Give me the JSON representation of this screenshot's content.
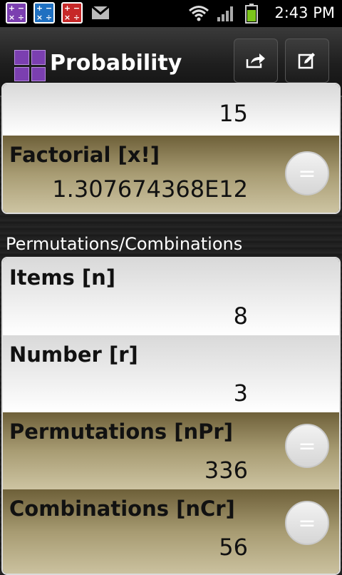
{
  "status_bar": {
    "time": "2:43 PM",
    "icons": [
      "calc-purple-icon",
      "calc-blue-icon",
      "calc-red-icon",
      "gmail-icon",
      "wifi-icon",
      "signal-icon",
      "battery-icon"
    ]
  },
  "action_bar": {
    "title": "Probability",
    "share_icon": "share-icon",
    "edit_icon": "edit-icon"
  },
  "factorial_section": {
    "input_value": "15",
    "factorial_label": "Factorial [x!]",
    "factorial_value": "1.307674368E12"
  },
  "perm_comb_section": {
    "title": "Permutations/Combinations",
    "items_label": "Items [n]",
    "items_value": "8",
    "number_label": "Number [r]",
    "number_value": "3",
    "permutations_label": "Permutations [nPr]",
    "permutations_value": "336",
    "combinations_label": "Combinations [nCr]",
    "combinations_value": "56",
    "equals_symbol": "="
  },
  "colors": {
    "accent_purple": "#7b3fb0",
    "gold_row": "#a89c73",
    "white_row": "#ffffff",
    "dark_bg": "#222222"
  }
}
